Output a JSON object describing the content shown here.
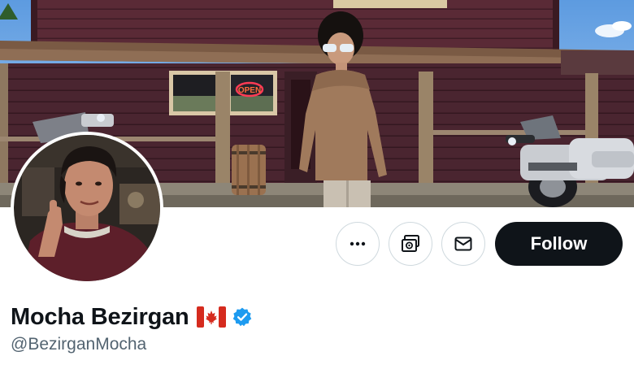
{
  "profile": {
    "display_name": "Mocha Bezirgan",
    "flag": "Canada flag emoji",
    "verified": true,
    "handle": "@BezirganMocha"
  },
  "actions": {
    "more_icon": "more-dots-icon",
    "subscribe_icon": "subscribe-icon",
    "message_icon": "mail-icon",
    "follow_label": "Follow"
  },
  "colors": {
    "follow_bg": "#0f1419",
    "verified_blue": "#1d9bf0",
    "handle_gray": "#536471",
    "border_gray": "#cfd9de",
    "flag_red": "#d52b1e"
  },
  "banner": {
    "neon_sign": "OPEN"
  }
}
